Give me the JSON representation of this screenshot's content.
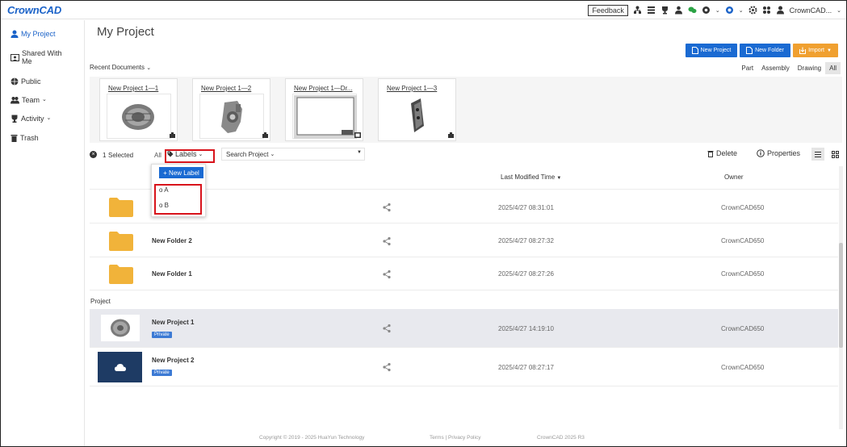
{
  "app": {
    "logo_text": "CrownCAD",
    "feedback_label": "Feedback",
    "user_label": "CrownCAD...",
    "brand_color": "#1a62c8"
  },
  "sidebar": {
    "items": [
      {
        "label": "My Project",
        "icon": "user-icon"
      },
      {
        "label": "Shared With",
        "label2": "Me",
        "icon": "shared-icon"
      },
      {
        "label": "Public",
        "icon": "globe-icon"
      },
      {
        "label": "Team",
        "icon": "team-icon"
      },
      {
        "label": "Activity",
        "icon": "trophy-icon"
      },
      {
        "label": "Trash",
        "icon": "trash-icon"
      }
    ]
  },
  "main": {
    "title": "My Project",
    "buttons": {
      "new_project": "New Project",
      "new_folder": "New Folder",
      "import": "Import"
    },
    "recent_label": "Recent Documents",
    "filter_tabs": [
      "Part",
      "Assembly",
      "Drawing",
      "All"
    ],
    "selected_filter": "All",
    "recent_cards": [
      {
        "title": "New Project 1—1"
      },
      {
        "title": "New Project 1—2"
      },
      {
        "title": "New Project 1—Dr..."
      },
      {
        "title": "New Project 1—3"
      }
    ],
    "toolbar": {
      "selected_count": "1",
      "selected_text": "Selected",
      "all_label": "All",
      "labels_label": "Labels",
      "search_label": "Search Project",
      "delete_label": "Delete",
      "properties_label": "Properties"
    },
    "table": {
      "col_modified": "Last Modified Time",
      "col_owner": "Owner"
    },
    "label_menu": {
      "new_label": "+ New Label",
      "options": [
        "o A",
        "o B"
      ]
    },
    "folders": [
      {
        "name": "",
        "time": "2025/4/27 08:31:01",
        "owner": "CrownCAD650"
      },
      {
        "name": "New Folder 2",
        "time": "2025/4/27 08:27:32",
        "owner": "CrownCAD650"
      },
      {
        "name": "New Folder 1",
        "time": "2025/4/27 08:27:26",
        "owner": "CrownCAD650"
      }
    ],
    "project_section": "Project",
    "projects": [
      {
        "name": "New Project 1",
        "badge": "Private",
        "time": "2025/4/27 14:19:10",
        "owner": "CrownCAD650"
      },
      {
        "name": "New Project 2",
        "badge": "Private",
        "time": "2025/4/27 08:27:17",
        "owner": "CrownCAD650"
      }
    ]
  },
  "footer": {
    "copyright": "Copyright © 2019 - 2025 HuaYun Technology",
    "terms": "Terms | Privacy Policy",
    "version": "CrownCAD 2025 R3"
  }
}
